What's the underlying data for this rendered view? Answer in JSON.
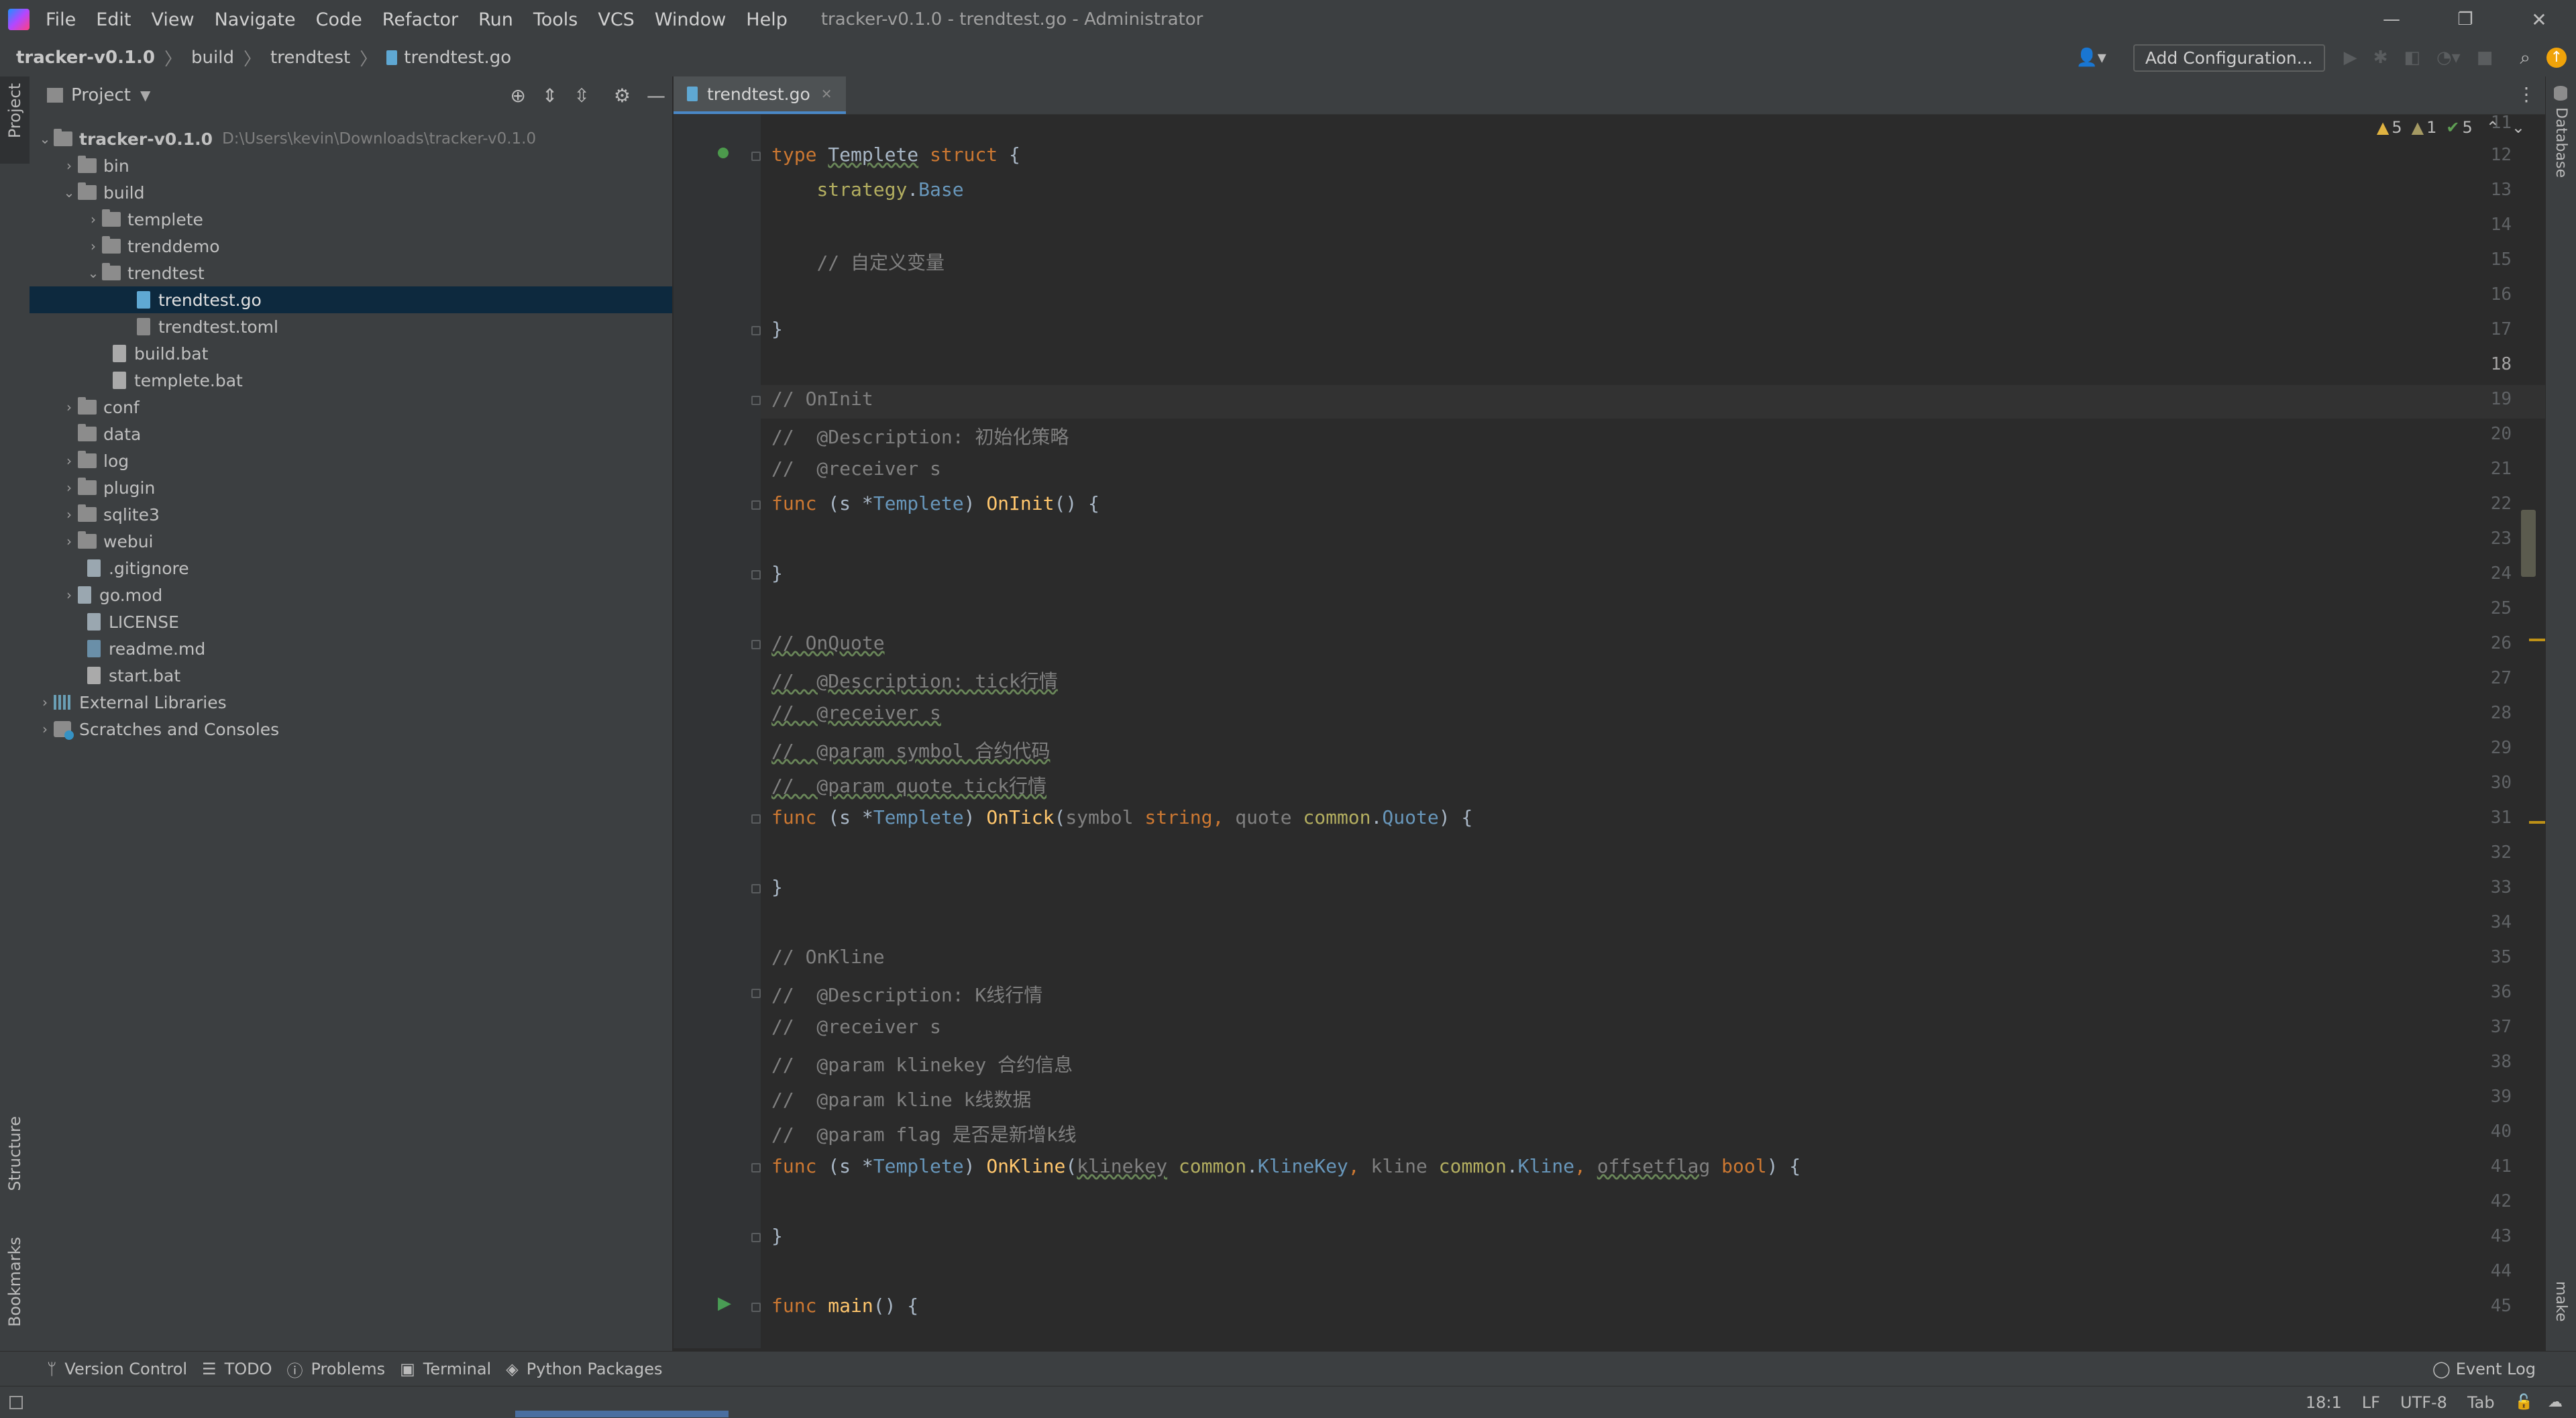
{
  "titlebar": {
    "menus": [
      "File",
      "Edit",
      "View",
      "Navigate",
      "Code",
      "Refactor",
      "Run",
      "Tools",
      "VCS",
      "Window",
      "Help"
    ],
    "title": "tracker-v0.1.0 - trendtest.go - Administrator"
  },
  "navbar": {
    "crumbs": [
      "tracker-v0.1.0",
      "build",
      "trendtest",
      "trendtest.go"
    ],
    "add_config": "Add Configuration..."
  },
  "left_stripe": {
    "project": "Project",
    "structure": "Structure",
    "bookmarks": "Bookmarks"
  },
  "right_stripe": {
    "database": "Database",
    "make": "make"
  },
  "project": {
    "title": "Project",
    "root_name": "tracker-v0.1.0",
    "root_path": "D:\\Users\\kevin\\Downloads\\tracker-v0.1.0",
    "items": [
      {
        "label": "bin"
      },
      {
        "label": "build"
      },
      {
        "label": "templete"
      },
      {
        "label": "trenddemo"
      },
      {
        "label": "trendtest"
      },
      {
        "label": "trendtest.go"
      },
      {
        "label": "trendtest.toml"
      },
      {
        "label": "build.bat"
      },
      {
        "label": "templete.bat"
      },
      {
        "label": "conf"
      },
      {
        "label": "data"
      },
      {
        "label": "log"
      },
      {
        "label": "plugin"
      },
      {
        "label": "sqlite3"
      },
      {
        "label": "webui"
      },
      {
        "label": ".gitignore"
      },
      {
        "label": "go.mod"
      },
      {
        "label": "LICENSE"
      },
      {
        "label": "readme.md"
      },
      {
        "label": "start.bat"
      },
      {
        "label": "External Libraries"
      },
      {
        "label": "Scratches and Consoles"
      }
    ]
  },
  "editor": {
    "tab": "trendtest.go",
    "inspections": {
      "warnings": "5",
      "weak": "1",
      "ok": "5"
    },
    "line_numbers": [
      "11",
      "12",
      "13",
      "14",
      "15",
      "16",
      "17",
      "18",
      "19",
      "20",
      "21",
      "22",
      "23",
      "24",
      "25",
      "26",
      "27",
      "28",
      "29",
      "30",
      "31",
      "32",
      "33",
      "34",
      "35",
      "36",
      "37",
      "38",
      "39",
      "40",
      "41",
      "42",
      "43",
      "44",
      "45"
    ],
    "code": {
      "l12_type": "type",
      "l12_name": "Templete",
      "l12_struct": "struct",
      "l12_brace": " {",
      "l13_pkg": "strategy",
      "l13_dot": ".",
      "l13_base": "Base",
      "l15": "// 自定义变量",
      "l17": "}",
      "l19": "// OnInit",
      "l20": "//  @Description: 初始化策略",
      "l21": "//  @receiver s",
      "l22_func": "func",
      "l22_a": " (s *",
      "l22_t": "Templete",
      "l22_b": ") ",
      "l22_fn": "OnInit",
      "l22_c": "() {",
      "l24": "}",
      "l26": "// OnQuote",
      "l27": "//  @Description: tick行情",
      "l28": "//  @receiver s",
      "l29": "//  @param symbol 合约代码",
      "l30": "//  @param quote tick行情",
      "l31_func": "func",
      "l31_a": " (s *",
      "l31_t": "Templete",
      "l31_b": ") ",
      "l31_fn": "OnTick",
      "l31_c": "(",
      "l31_p1": "symbol",
      "l31_s": " string",
      ", ": ", ",
      "l31_p2": "quote",
      "l31_pkg": " common",
      ".": ".",
      "l31_q": "Quote",
      "l31_d": ") {",
      "l33": "}",
      "l35": "// OnKline",
      "l36": "//  @Description: K线行情",
      "l37": "//  @receiver s",
      "l38": "//  @param klinekey 合约信息",
      "l39": "//  @param kline k线数据",
      "l40": "//  @param flag 是否是新增k线",
      "l41_func": "func",
      "l41_a": " (s *",
      "l41_t": "Templete",
      "l41_b": ") ",
      "l41_fn": "OnKline",
      "l41_c": "(",
      "l41_p1": "klinekey",
      "l41_pkg1": " common",
      "l41_kk": "KlineKey",
      "l41_p2": "kline",
      "l41_pkg2": " common",
      "l41_k": "Kline",
      "l41_p3": "offsetflag",
      "l41_bool": " bool",
      "l41_d": ") {",
      "l43": "}",
      "l45_func": "func",
      "l45_fn": " main",
      "l45_c": "() {"
    }
  },
  "bottom_tools": [
    "Version Control",
    "TODO",
    "Problems",
    "Terminal",
    "Python Packages"
  ],
  "event_log": "Event Log",
  "status": {
    "pos": "18:1",
    "lf": "LF",
    "enc": "UTF-8",
    "indent": "Tab"
  },
  "colors": {
    "accent": "#4a88c7",
    "selected_row": "#0d293e",
    "keyword": "#cc7832",
    "function": "#ffc66d",
    "type": "#6897bb",
    "comment": "#808080"
  }
}
